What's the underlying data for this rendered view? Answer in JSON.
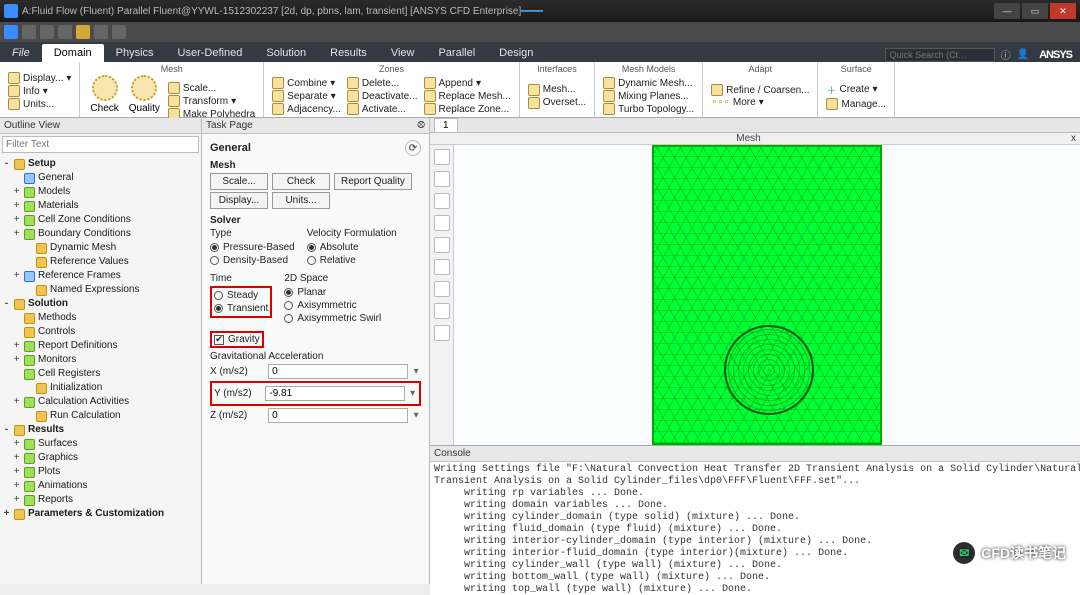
{
  "window": {
    "title": "A:Fluid Flow (Fluent) Parallel Fluent@YYWL-1512302237  [2d, dp, pbns, lam, transient]  [ANSYS CFD Enterprise]",
    "activity": "━━━━"
  },
  "menu": {
    "file": "File",
    "tabs": [
      "Domain",
      "Physics",
      "User-Defined",
      "Solution",
      "Results",
      "View",
      "Parallel",
      "Design"
    ],
    "active": 0,
    "search_placeholder": "Quick Search (Ct…",
    "logo": "ANSYS"
  },
  "ribbon": {
    "groups": [
      {
        "label": "",
        "items": [
          [
            "Display..."
          ],
          [
            "Info"
          ],
          [
            "Units..."
          ]
        ],
        "big": []
      },
      {
        "label": "Mesh",
        "items": [
          [
            "Scale..."
          ],
          [
            "Transform"
          ],
          [
            "Make Polyhedra"
          ]
        ],
        "big": [
          "Check",
          "Quality"
        ]
      },
      {
        "label": "Zones",
        "items": [
          [
            "Combine",
            "Delete...",
            "Append"
          ],
          [
            "Separate",
            "Deactivate...",
            "Replace Mesh..."
          ],
          [
            "Adjacency...",
            "Activate...",
            "Replace Zone..."
          ]
        ]
      },
      {
        "label": "Interfaces",
        "items": [
          [
            "Mesh..."
          ],
          [
            "Overset..."
          ]
        ]
      },
      {
        "label": "Mesh Models",
        "items": [
          [
            "Dynamic Mesh..."
          ],
          [
            "Mixing Planes..."
          ],
          [
            "Turbo Topology..."
          ]
        ]
      },
      {
        "label": "Adapt",
        "items": [
          [
            "Refine / Coarsen..."
          ],
          [
            "More"
          ]
        ]
      },
      {
        "label": "Surface",
        "items": [
          [
            "Create"
          ],
          [
            "Manage..."
          ]
        ]
      }
    ]
  },
  "outline": {
    "header": "Outline View",
    "filter_placeholder": "Filter Text",
    "nodes": [
      {
        "l": 1,
        "t": "Setup",
        "tw": "-"
      },
      {
        "l": 2,
        "t": "General",
        "i": "b"
      },
      {
        "l": 2,
        "t": "Models",
        "tw": "+",
        "i": "g"
      },
      {
        "l": 2,
        "t": "Materials",
        "tw": "+",
        "i": "g"
      },
      {
        "l": 2,
        "t": "Cell Zone Conditions",
        "tw": "+",
        "i": "g"
      },
      {
        "l": 2,
        "t": "Boundary Conditions",
        "tw": "+",
        "i": "g"
      },
      {
        "l": 3,
        "t": "Dynamic Mesh",
        "i": "y"
      },
      {
        "l": 3,
        "t": "Reference Values",
        "i": "y"
      },
      {
        "l": 2,
        "t": "Reference Frames",
        "tw": "+",
        "i": "b"
      },
      {
        "l": 3,
        "t": "Named Expressions",
        "i": "y"
      },
      {
        "l": 1,
        "t": "Solution",
        "tw": "-"
      },
      {
        "l": 2,
        "t": "Methods",
        "i": "y"
      },
      {
        "l": 2,
        "t": "Controls",
        "i": "y"
      },
      {
        "l": 2,
        "t": "Report Definitions",
        "tw": "+",
        "i": "g"
      },
      {
        "l": 2,
        "t": "Monitors",
        "tw": "+",
        "i": "g"
      },
      {
        "l": 2,
        "t": "Cell Registers",
        "i": "g"
      },
      {
        "l": 3,
        "t": "Initialization",
        "i": "y"
      },
      {
        "l": 2,
        "t": "Calculation Activities",
        "tw": "+",
        "i": "g"
      },
      {
        "l": 3,
        "t": "Run Calculation",
        "i": "y"
      },
      {
        "l": 1,
        "t": "Results",
        "tw": "-"
      },
      {
        "l": 2,
        "t": "Surfaces",
        "tw": "+",
        "i": "g"
      },
      {
        "l": 2,
        "t": "Graphics",
        "tw": "+",
        "i": "g"
      },
      {
        "l": 2,
        "t": "Plots",
        "tw": "+",
        "i": "g"
      },
      {
        "l": 2,
        "t": "Animations",
        "tw": "+",
        "i": "g"
      },
      {
        "l": 2,
        "t": "Reports",
        "tw": "+",
        "i": "g"
      },
      {
        "l": 1,
        "t": "Parameters & Customization",
        "tw": "+"
      }
    ]
  },
  "task": {
    "header": "Task Page",
    "title": "General",
    "mesh": {
      "label": "Mesh",
      "buttons": [
        "Scale...",
        "Check",
        "Report Quality",
        "Display...",
        "Units..."
      ]
    },
    "solver": {
      "label": "Solver",
      "type": {
        "label": "Type",
        "opts": [
          "Pressure-Based",
          "Density-Based"
        ],
        "sel": 0
      },
      "vel": {
        "label": "Velocity Formulation",
        "opts": [
          "Absolute",
          "Relative"
        ],
        "sel": 0
      },
      "time": {
        "label": "Time",
        "opts": [
          "Steady",
          "Transient"
        ],
        "sel": 1
      },
      "space": {
        "label": "2D Space",
        "opts": [
          "Planar",
          "Axisymmetric",
          "Axisymmetric Swirl"
        ],
        "sel": 0
      }
    },
    "gravity": {
      "label": "Gravity",
      "checked": true,
      "accel_label": "Gravitational Acceleration",
      "x": {
        "label": "X (m/s2)",
        "v": "0"
      },
      "y": {
        "label": "Y (m/s2)",
        "v": "-9.81"
      },
      "z": {
        "label": "Z (m/s2)",
        "v": "0"
      }
    }
  },
  "gfx": {
    "tab": "1",
    "header": "Mesh",
    "close": "x"
  },
  "console": {
    "header": "Console",
    "text": "Writing Settings file \"F:\\Natural Convection Heat Transfer 2D Transient Analysis on a Solid Cylinder\\Natural Convection Heat Transfer 2D\nTransient Analysis on a Solid Cylinder_files\\dp0\\FFF\\Fluent\\FFF.set\"...\n     writing rp variables ... Done.\n     writing domain variables ... Done.\n     writing cylinder_domain (type solid) (mixture) ... Done.\n     writing fluid_domain (type fluid) (mixture) ... Done.\n     writing interior-cylinder_domain (type interior) (mixture) ... Done.\n     writing interior-fluid_domain (type interior)(mixture) ... Done.\n     writing cylinder_wall (type wall) (mixture) ... Done.\n     writing bottom_wall (type wall) (mixture) ... Done.\n     writing top_wall (type wall) (mixture) ... Done.\n     writing side_wall_l (type wall) (mixture) ... Done.\n     writing side_wall_r (type wall) (mixture) ... Done.\n     writing cylinder_wall-shadow (type wall) (mixture) ... Done.\n     writing zones map name-id ... Done."
  },
  "watermark": "CFD读书笔记"
}
